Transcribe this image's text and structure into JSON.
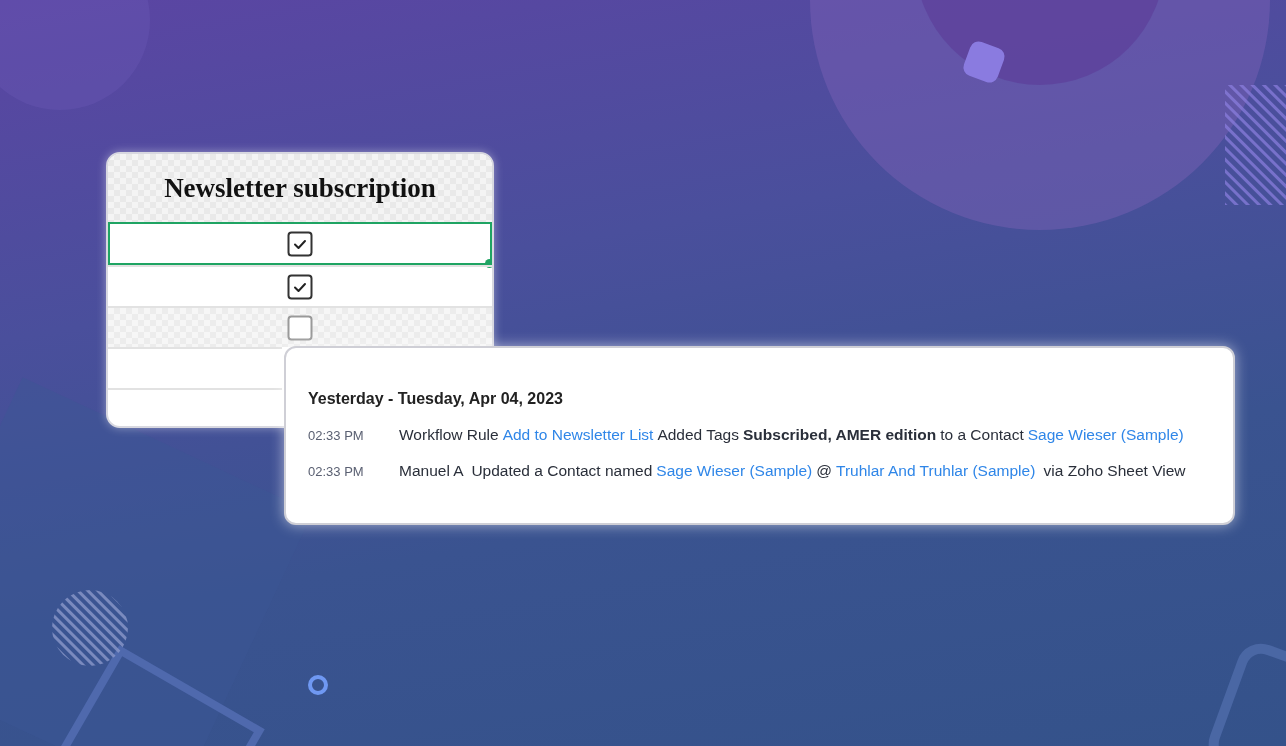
{
  "subscription_table": {
    "header": "Newsletter subscription",
    "rows": [
      {
        "kind": "checkbox",
        "checked": true,
        "selected": true
      },
      {
        "kind": "checkbox",
        "checked": true,
        "selected": false
      },
      {
        "kind": "checkbox",
        "checked": false,
        "selected": false
      },
      {
        "kind": "blank",
        "selected": false
      },
      {
        "kind": "blank",
        "selected": false
      }
    ]
  },
  "timeline": {
    "date_heading": "Yesterday - Tuesday, Apr 04, 2023",
    "entries": [
      {
        "time": "02:33 PM",
        "segments": [
          {
            "kind": "text",
            "text": "Workflow Rule"
          },
          {
            "kind": "link",
            "text": "Add to Newsletter List"
          },
          {
            "kind": "text",
            "text": "Added Tags"
          },
          {
            "kind": "bold",
            "text": "Subscribed, AMER edition"
          },
          {
            "kind": "text",
            "text": "to a Contact"
          },
          {
            "kind": "link",
            "text": "Sage Wieser (Sample)"
          }
        ]
      },
      {
        "time": "02:33 PM",
        "segments": [
          {
            "kind": "text",
            "text": "Manuel A  Updated a Contact named"
          },
          {
            "kind": "link",
            "text": "Sage Wieser (Sample)"
          },
          {
            "kind": "text",
            "text": "@"
          },
          {
            "kind": "link",
            "text": "Truhlar And Truhlar (Sample)"
          },
          {
            "kind": "text",
            "text": " via Zoho Sheet View"
          }
        ]
      }
    ]
  }
}
